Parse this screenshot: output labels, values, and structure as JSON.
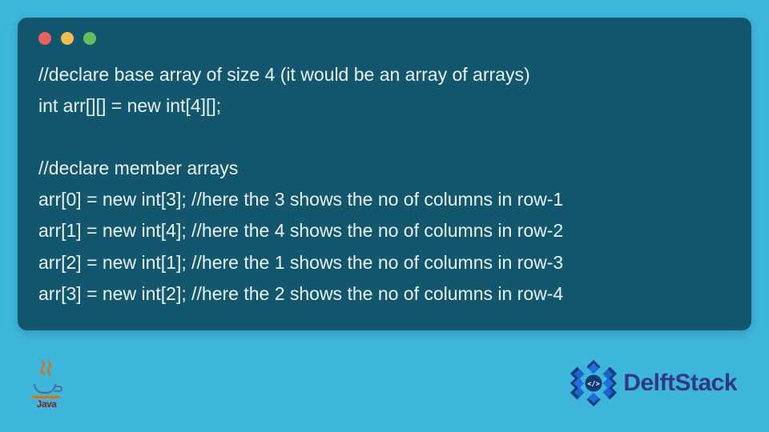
{
  "code": {
    "comment1": "//declare base array of size 4 (it would be an array of arrays)",
    "declare": "int arr[][] = new int[4][];",
    "comment2": "//declare member arrays",
    "line0": "arr[0] = new int[3]; //here the 3 shows the no of columns in row-1",
    "line1": "arr[1] = new int[4]; //here the 4 shows the no of columns in row-2",
    "line2": "arr[2] = new int[1]; //here the 1 shows the no of columns in row-3",
    "line3": "arr[3] = new int[2]; //here the 2 shows the no of columns in row-4"
  },
  "footer": {
    "java_label": "Java",
    "brand": "DelftStack"
  }
}
